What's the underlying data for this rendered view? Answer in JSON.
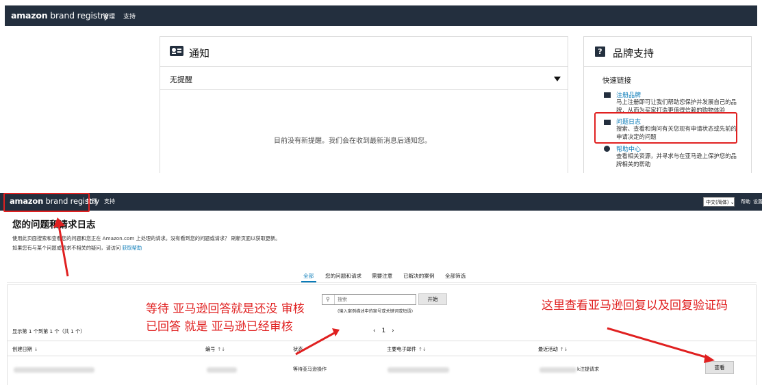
{
  "top": {
    "brand": {
      "prefix": "amazon",
      "suffix": " brand registry"
    },
    "nav": [
      "管理",
      "支持"
    ],
    "notifications": {
      "title": "通知",
      "filter_value": "无提醒",
      "empty_message": "目前没有新提醒。我们会在收到最新消息后通知您。"
    },
    "support": {
      "title": "品牌支持",
      "help_glyph": "?",
      "quick_links_title": "快速链接",
      "links": [
        {
          "title": "注册品牌",
          "desc1": "马上注册即可让我们帮助您保护并发展自己的品",
          "desc2": "牌，从而为买家打造更值得信赖的购物体验"
        },
        {
          "title": "问题日志",
          "desc1": "搜索、查看和询问有关您现有申请状态或先前的",
          "desc2": "申请决定的问题"
        },
        {
          "title": "帮助中心",
          "desc1": "查看相关资源，并寻求与在亚马逊上保护您的品",
          "desc2": "牌相关的帮助"
        }
      ]
    }
  },
  "bottom": {
    "brand": {
      "prefix": "amazon",
      "suffix": " brand registry"
    },
    "nav": [
      "管理",
      "支持"
    ],
    "language": "中文(简体)",
    "account_links": [
      "帮助",
      "设置"
    ],
    "page_title": "您的问题和请求日志",
    "description": {
      "line1": "使用此页面搜索和查看您的问题和您正在 Amazon.com 上处理的请求。没有看到您的问题或请求？ 刷新页面以获取更新。",
      "line2_prefix": "如果您有与某个问题或请求不相关的疑问，请访问 ",
      "line2_link": "获取帮助"
    },
    "tabs": [
      "全部",
      "您的问题和请求",
      "需要注意",
      "已解决的案例",
      "全部筛选"
    ],
    "active_tab": 0,
    "search": {
      "placeholder": "搜索",
      "button": "开始",
      "hint": "(输入案例描述中的案号或关键词或短语)"
    },
    "showing_text": "显示第 1 个到第 1 个（共 1 个）",
    "pager": {
      "prev": "‹",
      "page": "1",
      "next": "›"
    },
    "columns": [
      {
        "label": "创建日期",
        "sort": "↓"
      },
      {
        "label": "编号",
        "sort": "↑↓"
      },
      {
        "label": "状态",
        "sort": ""
      },
      {
        "label": "主要电子邮件",
        "sort": "↑↓"
      },
      {
        "label": "最近活动",
        "sort": "↑↓"
      }
    ],
    "rows": [
      {
        "status": "等待亚马逊操作",
        "activity_suffix": "k注提请求",
        "action": "查看"
      }
    ]
  },
  "annotations": {
    "left_line1": "等待 亚马逊回答就是还没 审核",
    "left_line2": "已回答 就是 亚马逊已经审核",
    "right": "这里查看亚马逊回复以及回复验证码"
  },
  "colors": {
    "nav_bg": "#232f3e",
    "link": "#0a7bb8",
    "annotation_red": "#e02020"
  },
  "icons": {
    "notice": "id-card-icon",
    "help": "question-square-icon",
    "register_brand": "folder-icon",
    "case_log": "briefcase-icon",
    "help_center": "question-circle-icon",
    "search": "magnifier-icon"
  }
}
